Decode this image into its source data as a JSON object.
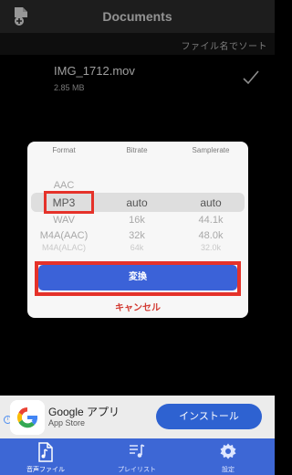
{
  "header": {
    "title": "Documents",
    "add_icon": "add-document-icon"
  },
  "sort": {
    "label": "ファイル名でソート"
  },
  "file": {
    "name": "IMG_1712.mov",
    "size": "2.85 MB",
    "status_icon": "check-icon"
  },
  "dialog": {
    "columns": {
      "format": "Format",
      "bitrate": "Bitrate",
      "samplerate": "Samplerate"
    },
    "format_options": [
      "AAC",
      "MP3",
      "WAV",
      "M4A(AAC)",
      "M4A(ALAC)"
    ],
    "bitrate_options": [
      "auto",
      "16k",
      "32k",
      "64k"
    ],
    "samplerate_options": [
      "auto",
      "44.1k",
      "48.0k",
      "32.0k"
    ],
    "selected": {
      "format": "MP3",
      "bitrate": "auto",
      "samplerate": "auto"
    },
    "convert_label": "変換",
    "cancel_label": "キャンセル"
  },
  "ad": {
    "title": "Google アプリ",
    "subtitle": "App Store",
    "install_label": "インストール",
    "info_icon": "ad-info-icon",
    "logo": "google-logo"
  },
  "tabs": [
    {
      "label": "音声ファイル",
      "icon": "audio-file-icon",
      "active": true
    },
    {
      "label": "プレイリスト",
      "icon": "playlist-icon",
      "active": false
    },
    {
      "label": "設定",
      "icon": "gear-icon",
      "active": false
    }
  ],
  "colors": {
    "accent": "#3d67d5",
    "highlight": "#e5322a",
    "cancel": "#d23a32",
    "header": "#2d2d2d"
  }
}
